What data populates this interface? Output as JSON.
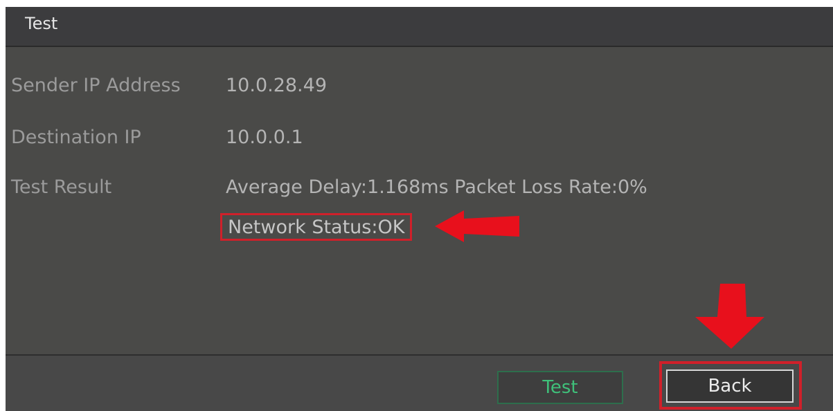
{
  "dialog": {
    "title": "Test"
  },
  "fields": {
    "sender_ip": {
      "label": "Sender IP Address",
      "value": "10.0.28.49"
    },
    "destination_ip": {
      "label": "Destination IP",
      "value": "10.0.0.1"
    },
    "test_result": {
      "label": "Test Result",
      "value": "Average Delay:1.168ms  Packet Loss Rate:0%",
      "network_status": "Network Status:OK"
    }
  },
  "buttons": {
    "test_label": "Test",
    "back_label": "Back"
  },
  "colors": {
    "annotation": "#d0202a",
    "test_button_text": "#3fc07a"
  }
}
